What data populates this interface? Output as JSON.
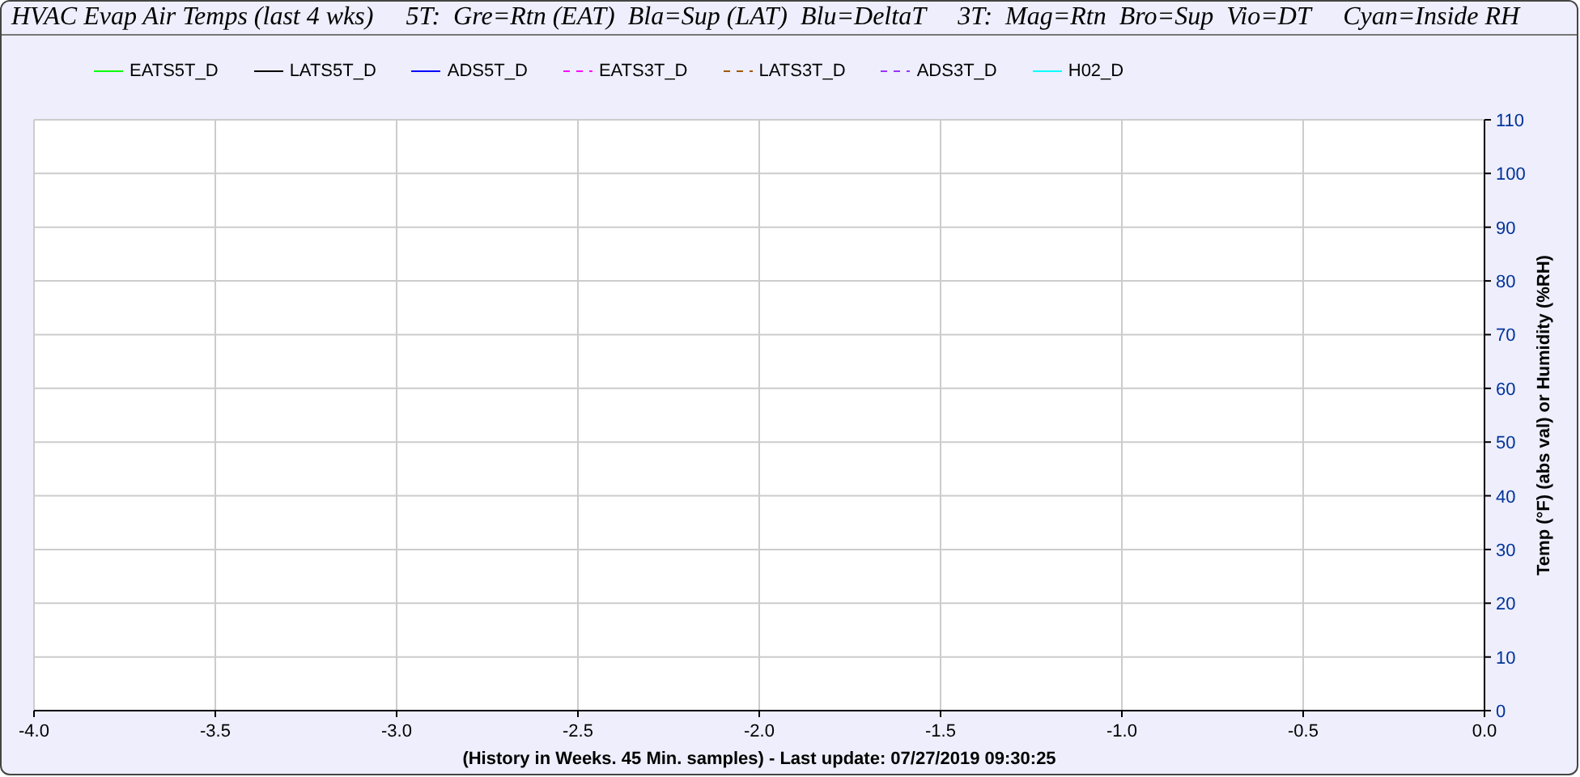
{
  "title": "HVAC Evap Air Temps (last 4 wks)     5T:  Gre=Rtn (EAT)  Bla=Sup (LAT)  Blu=DeltaT     3T:  Mag=Rtn  Bro=Sup  Vio=DT     Cyan=Inside RH",
  "chart": {
    "legend": [
      {
        "label": "EATS5T_D",
        "color": "#00ff00",
        "dashed": false
      },
      {
        "label": "LATS5T_D",
        "color": "#000000",
        "dashed": false
      },
      {
        "label": "ADS5T_D",
        "color": "#0000ff",
        "dashed": false
      },
      {
        "label": "EATS3T_D",
        "color": "#ff00ff",
        "dashed": true
      },
      {
        "label": "LATS3T_D",
        "color": "#a05a00",
        "dashed": true
      },
      {
        "label": "ADS3T_D",
        "color": "#9933ff",
        "dashed": true
      },
      {
        "label": "H02_D",
        "color": "#00ffff",
        "dashed": false
      }
    ],
    "chart_data": {
      "type": "line",
      "xlabel": "(History in Weeks. 45 Min. samples) - Last update: 07/27/2019 09:30:25",
      "ylabel": "Temp (°F) (abs val) or Humidity (%RH)",
      "grid": true,
      "ylim": [
        0,
        110
      ],
      "categories": [
        "-4.0",
        "-3.5",
        "-3.0",
        "-2.5",
        "-2.0",
        "-1.5",
        "-1.0",
        "-0.5",
        "0.0"
      ],
      "yticks": [
        0,
        10,
        20,
        30,
        40,
        50,
        60,
        70,
        80,
        90,
        100,
        110
      ]
    }
  }
}
